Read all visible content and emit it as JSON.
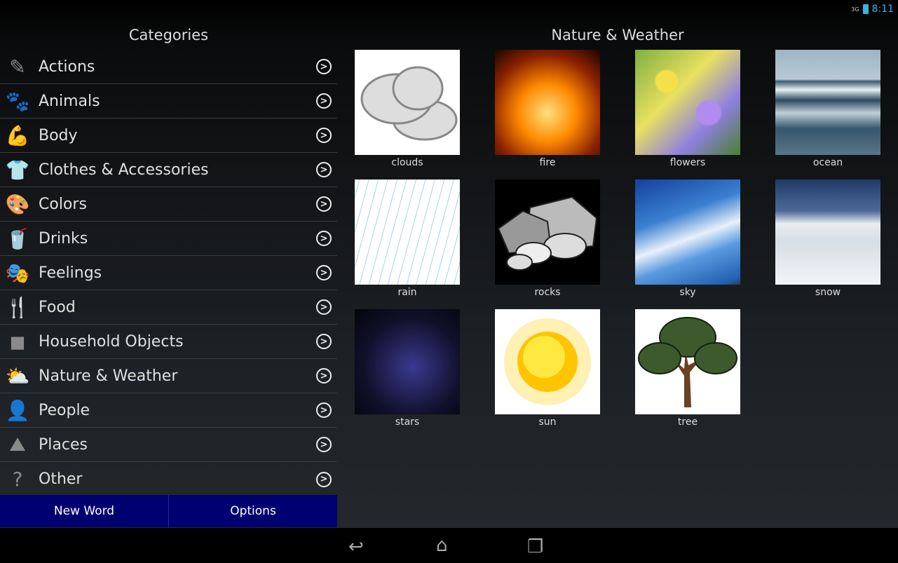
{
  "status": {
    "network": "3G",
    "time": "8:11"
  },
  "sidebar": {
    "title": "Categories",
    "items": [
      {
        "label": "Actions",
        "icon": "actions-icon",
        "glyph": "✎"
      },
      {
        "label": "Animals",
        "icon": "paw-icon",
        "glyph": "🐾"
      },
      {
        "label": "Body",
        "icon": "arm-icon",
        "glyph": "💪"
      },
      {
        "label": "Clothes & Accessories",
        "icon": "shirt-icon",
        "glyph": "👕"
      },
      {
        "label": "Colors",
        "icon": "paint-icon",
        "glyph": "🎨"
      },
      {
        "label": "Drinks",
        "icon": "cup-icon",
        "glyph": "🥤"
      },
      {
        "label": "Feelings",
        "icon": "masks-icon",
        "glyph": "🎭"
      },
      {
        "label": "Food",
        "icon": "utensils-icon",
        "glyph": "🍴"
      },
      {
        "label": "Household Objects",
        "icon": "shapes-icon",
        "glyph": "◼"
      },
      {
        "label": "Nature & Weather",
        "icon": "cloud-sun-icon",
        "glyph": "⛅"
      },
      {
        "label": "People",
        "icon": "person-icon",
        "glyph": "👤"
      },
      {
        "label": "Places",
        "icon": "mountains-icon",
        "glyph": "⛰"
      },
      {
        "label": "Other",
        "icon": "question-icon",
        "glyph": "?"
      }
    ],
    "arrow_glyph": ">"
  },
  "buttons": {
    "new_word": "New Word",
    "options": "Options"
  },
  "main": {
    "title": "Nature & Weather",
    "tiles": [
      {
        "label": "clouds",
        "bg": "#ffffff"
      },
      {
        "label": "fire",
        "bg": "radial-gradient(circle at 50% 60%,#ffe080,#ff8a00 35%,#8a2000 70%,#1a0500)"
      },
      {
        "label": "flowers",
        "bg": "radial-gradient(circle at 30% 30%,#f6e04a 10%,transparent 12%),radial-gradient(circle at 70% 60%,#b08cf0 12%,transparent 14%),linear-gradient(135deg,#7fb040,#e8e060 40%,#9080e0 70%,#4a8030)"
      },
      {
        "label": "ocean",
        "bg": "linear-gradient(#9fb4c4 0%,#b8c8d4 28%,#3c5a70 30%,#e6eef2 38%,#2d4a5e 48%,#c0d0da 60%,#35566c 75%,#5a7688)"
      },
      {
        "label": "rain",
        "bg": "repeating-linear-gradient(105deg,#fff 0 6px,#a8d4ec 6px 7px,#fff 7px 13px)"
      },
      {
        "label": "rocks",
        "bg": "#000000"
      },
      {
        "label": "sky",
        "bg": "linear-gradient(160deg,#1440a0 0%,#3a80d0 35%,#e8f0fa 55%,#5a9ae0 70%,#2060b0 95%,#303a44)"
      },
      {
        "label": "snow",
        "bg": "linear-gradient(#203a68 0%,#4c6a98 30%,#e8ecf0 42%,#d8dee6 60%,#f2f4f6)"
      },
      {
        "label": "stars",
        "bg": "radial-gradient(circle at 55% 55%,#3a3a90,#10102a 60%,#05050c)"
      },
      {
        "label": "sun",
        "bg": "#ffffff"
      },
      {
        "label": "tree",
        "bg": "#ffffff"
      }
    ]
  },
  "navbar": {
    "back": "back-icon",
    "home": "home-icon",
    "recents": "recents-icon"
  }
}
